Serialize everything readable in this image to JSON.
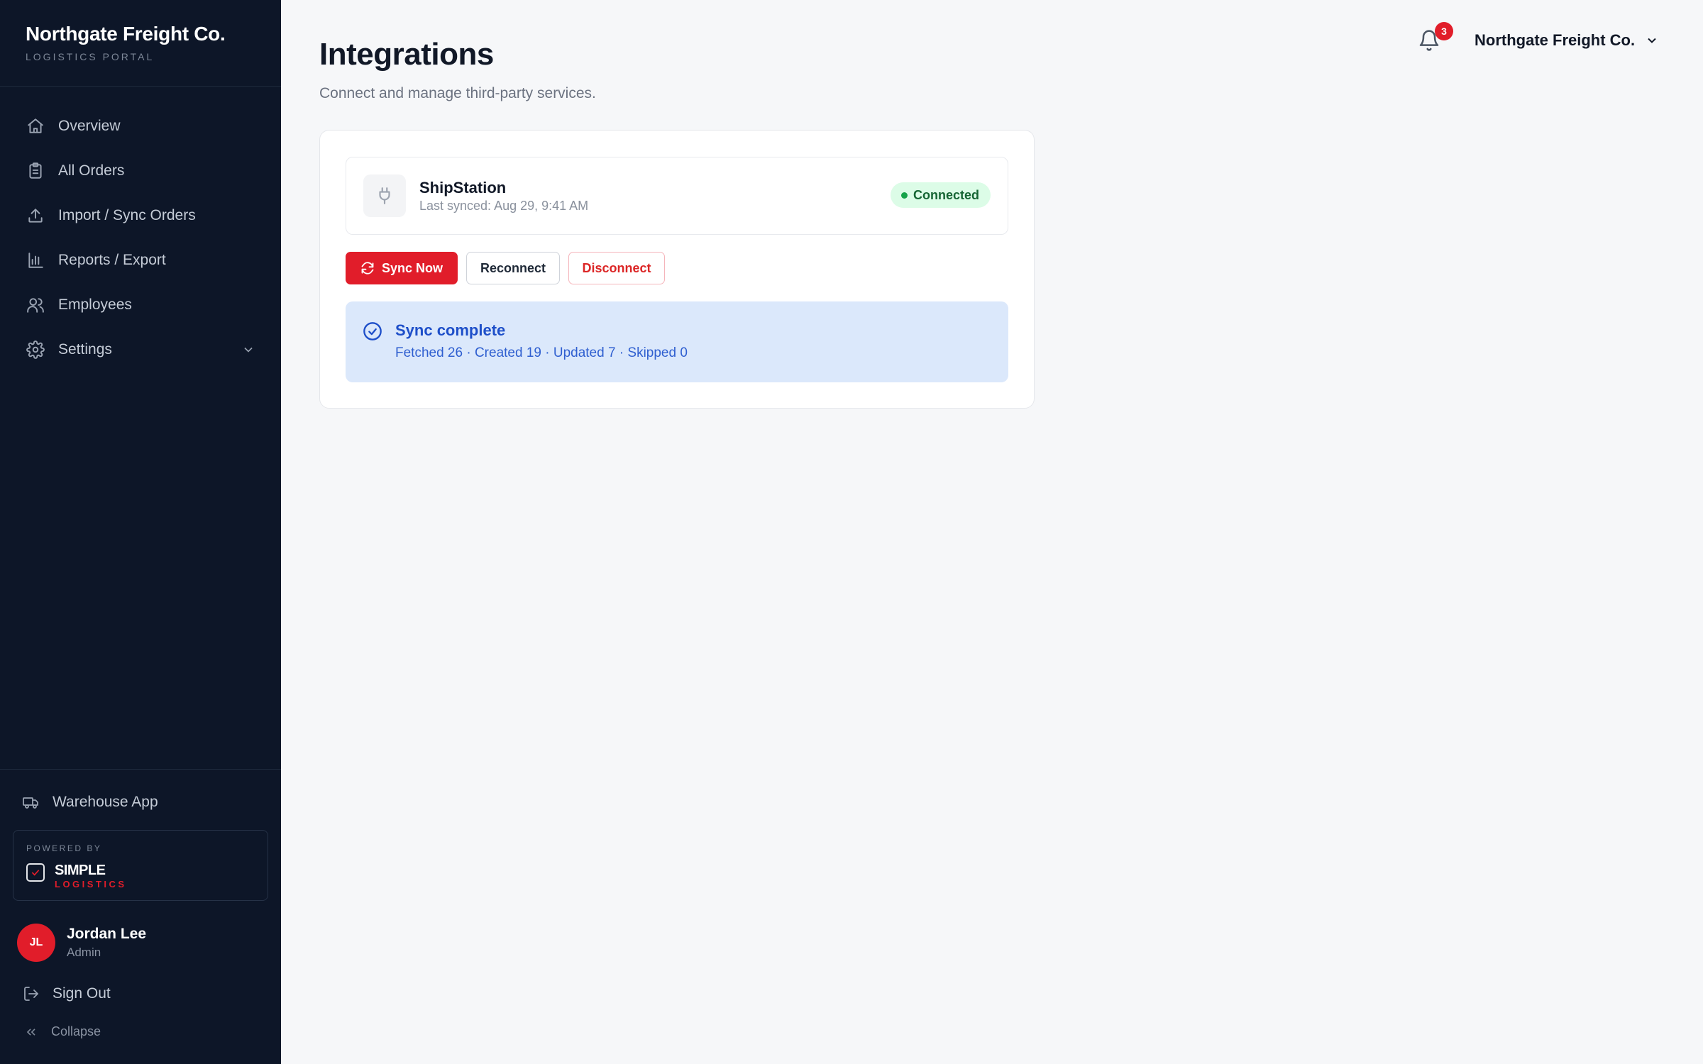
{
  "brand": {
    "name": "Northgate Freight Co.",
    "subtitle": "LOGISTICS PORTAL"
  },
  "sidebar": {
    "items": [
      {
        "label": "Overview",
        "icon": "home-icon"
      },
      {
        "label": "All Orders",
        "icon": "clipboard-icon"
      },
      {
        "label": "Import / Sync Orders",
        "icon": "upload-icon"
      },
      {
        "label": "Reports / Export",
        "icon": "bar-chart-icon"
      },
      {
        "label": "Employees",
        "icon": "users-icon"
      },
      {
        "label": "Settings",
        "icon": "gear-icon",
        "expandable": true
      }
    ],
    "warehouse_app": "Warehouse App",
    "powered_by": "POWERED BY",
    "powered_name": "SIMPLE",
    "powered_name2": "LOGISTICS",
    "sign_out": "Sign Out",
    "collapse": "Collapse"
  },
  "user": {
    "initials": "JL",
    "name": "Jordan Lee",
    "role": "Admin"
  },
  "header": {
    "notification_count": "3",
    "org_name": "Northgate Freight Co."
  },
  "page": {
    "title": "Integrations",
    "subtitle": "Connect and manage third-party services."
  },
  "integration": {
    "name": "ShipStation",
    "last_synced": "Last synced: Aug 29, 9:41 AM",
    "status": "Connected",
    "sync_label": "Sync Now",
    "reconnect_label": "Reconnect",
    "disconnect_label": "Disconnect"
  },
  "alert": {
    "title": "Sync complete",
    "detail": "Fetched 26 · Created 19 · Updated 7 · Skipped 0"
  },
  "colors": {
    "sidebar_bg": "#0d1628",
    "accent": "#e11d2a",
    "success": "#16a34a",
    "info": "#1e4fc9"
  }
}
